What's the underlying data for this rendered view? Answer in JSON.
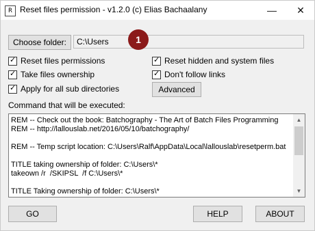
{
  "window": {
    "title": "Reset files permission - v1.2.0 (c) Elias Bachaalany",
    "app_icon": "R",
    "minimize_glyph": "—",
    "close_glyph": "✕"
  },
  "folder": {
    "button_label": "Choose folder:",
    "value": "C:\\Users",
    "badge": "1"
  },
  "options": {
    "reset_permissions": {
      "label": "Reset files permissions",
      "checked": true
    },
    "take_ownership": {
      "label": "Take files ownership",
      "checked": true
    },
    "apply_subdirs": {
      "label": "Apply for all sub directories",
      "checked": true
    },
    "reset_hidden": {
      "label": "Reset hidden and system files",
      "checked": true
    },
    "dont_follow_links": {
      "label": "Don't follow links",
      "checked": true
    },
    "check_glyph": "✓"
  },
  "advanced_label": "Advanced",
  "command": {
    "heading": "Command that will be executed:",
    "lines": [
      "REM -- Check out the book: Batchography - The Art of Batch Files Programming",
      "REM -- http://lallouslab.net/2016/05/10/batchography/",
      "",
      "REM -- Temp script location: C:\\Users\\Ralf\\AppData\\Local\\lallouslab\\resetperm.bat",
      "",
      "TITLE taking ownership of folder: C:\\Users\\*",
      "takeown /r  /SKIPSL  /f C:\\Users\\*",
      "",
      "TITLE Taking ownership of folder: C:\\Users\\*"
    ],
    "scroll_up": "▲",
    "scroll_down": "▼"
  },
  "footer": {
    "go_label": "GO",
    "help_label": "HELP",
    "about_label": "ABOUT"
  }
}
